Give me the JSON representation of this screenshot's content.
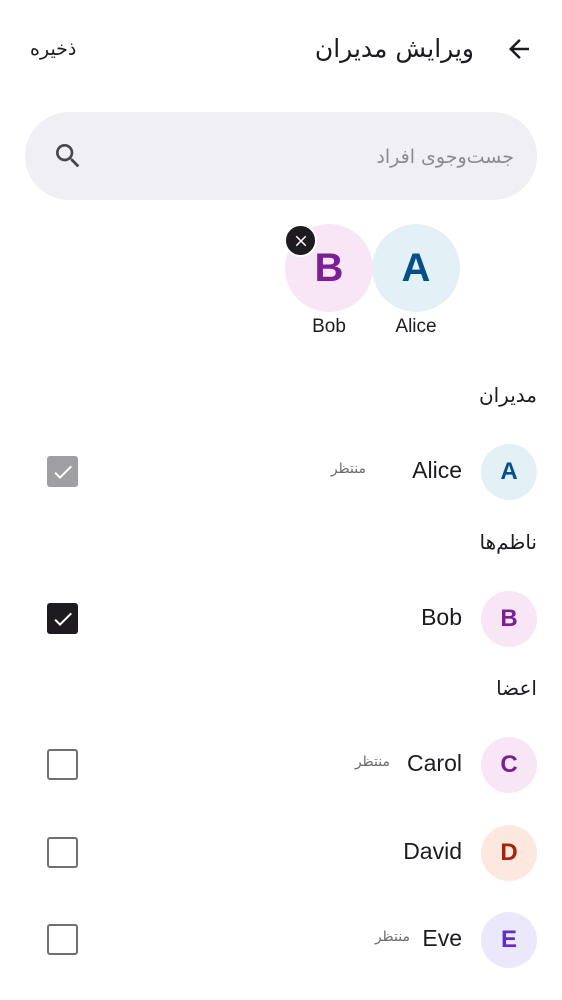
{
  "header": {
    "title": "ویرایش مدیران",
    "save_label": "ذخیره",
    "back_icon": "arrow-back-icon"
  },
  "search": {
    "placeholder": "جست‌وجوی افراد",
    "value": "",
    "icon": "search-icon"
  },
  "selected": [
    {
      "initial": "A",
      "name": "Alice",
      "bg": "#e3f1f7",
      "fg": "#06508a"
    },
    {
      "initial": "B",
      "name": "Bob",
      "bg": "#f8e6f6",
      "fg": "#7b1f95",
      "removable": true
    }
  ],
  "sections": {
    "admins": {
      "header": "مدیران",
      "items": [
        {
          "initial": "A",
          "name": "Alice",
          "status": "منتظر",
          "checked": true,
          "disabled": true,
          "bg": "#e3f1f7",
          "fg": "#06508a"
        }
      ]
    },
    "moderators": {
      "header": "ناظم‌ها",
      "items": [
        {
          "initial": "B",
          "name": "Bob",
          "status": "",
          "checked": true,
          "disabled": false,
          "bg": "#f8e6f6",
          "fg": "#7b1f95"
        }
      ]
    },
    "members": {
      "header": "اعضا",
      "items": [
        {
          "initial": "C",
          "name": "Carol",
          "status": "منتظر",
          "checked": false,
          "disabled": false,
          "bg": "#f8e6f6",
          "fg": "#7b1f95"
        },
        {
          "initial": "D",
          "name": "David",
          "status": "",
          "checked": false,
          "disabled": false,
          "bg": "#fde8e0",
          "fg": "#a3260c"
        },
        {
          "initial": "E",
          "name": "Eve",
          "status": "منتظر",
          "checked": false,
          "disabled": false,
          "bg": "#ece8fb",
          "fg": "#5e2ec9"
        }
      ]
    }
  }
}
